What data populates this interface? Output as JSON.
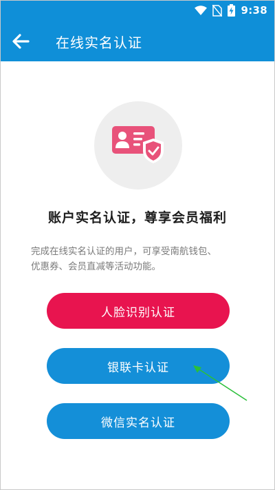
{
  "status_bar": {
    "time": "9:38",
    "icons": [
      "wifi-icon",
      "no-sim-icon",
      "battery-charging-icon"
    ]
  },
  "header": {
    "back_icon": "arrow-left-icon",
    "title": "在线实名认证"
  },
  "hero": {
    "icon": "id-card-shield-check-icon",
    "circle_color": "#eeeeee",
    "icon_color": "#e8527a"
  },
  "main": {
    "headline": "账户实名认证，尊享会员福利",
    "description_lines": [
      "完成在线实名认证的用户，可享受南航钱包、",
      "优惠券、会员直减等活动功能。"
    ]
  },
  "buttons": [
    {
      "label": "人脸识别认证",
      "color": "#e8144f"
    },
    {
      "label": "银联卡认证",
      "color": "#148fd8"
    },
    {
      "label": "微信实名认证",
      "color": "#148fd8"
    }
  ],
  "annotation": {
    "icon": "green-arrow-icon",
    "color": "#2bbf3a"
  },
  "colors": {
    "primary": "#0f8fd8",
    "accent": "#e8144f"
  }
}
